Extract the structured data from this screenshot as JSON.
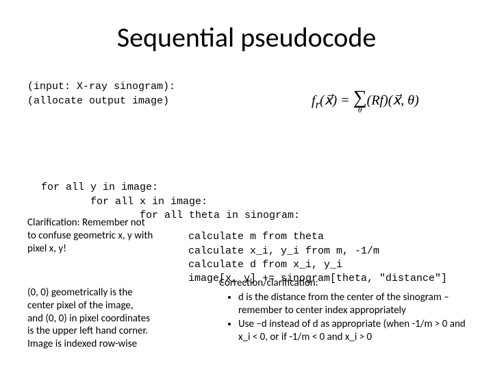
{
  "title": "Sequential pseudocode",
  "input_line1": "(input: X-ray sinogram):",
  "input_line2": "(allocate output image)",
  "formula": {
    "lhs": "f",
    "lhs_sub": "r",
    "arg": "(x⃗) = ",
    "sum_sub": "θ",
    "rhs": "(Rf)(x⃗, θ)"
  },
  "loop": {
    "l1": "for all y in image:",
    "l2": "        for all x in image:",
    "l3": "                for all theta in sinogram:",
    "l4": "calculate m from theta",
    "l5": "calculate x_i, y_i from m, -1/m",
    "l6": "calculate d from x_i, y_i",
    "l7": "image[x, y] += sinogram[theta, \"distance\"]"
  },
  "clar1": {
    "t1": "Clarification: Remember not",
    "t2": "to confuse geometric x, y with",
    "t3": "pixel x, y!"
  },
  "clar2": {
    "t1": "(0, 0) geometrically is the",
    "t2": "center pixel of the image,",
    "t3": "and (0, 0) in pixel coordinates",
    "t4": "is the upper left hand corner.",
    "t5": "Image is indexed row-wise"
  },
  "clar3": {
    "heading": "Correction/clarification:",
    "b1": "d is the distance from the center of the sinogram – remember to center index appropriately",
    "b2": "Use –d instead of d as appropriate (when -1/m > 0 and x_i < 0, or if -1/m < 0 and x_i > 0"
  }
}
